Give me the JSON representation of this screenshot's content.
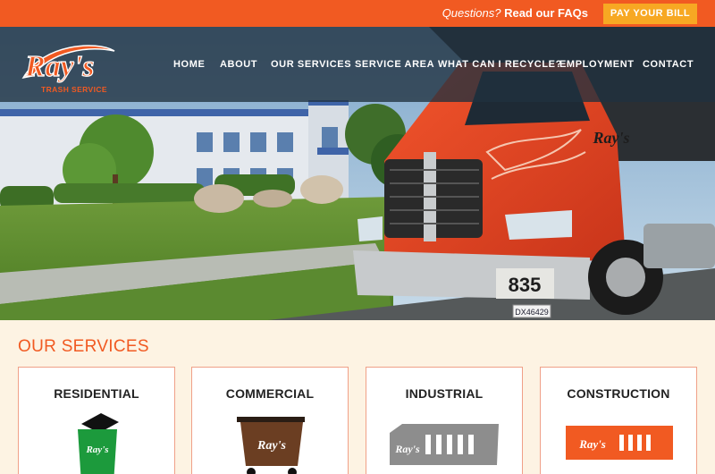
{
  "topbar": {
    "faq_prefix": "Questions?",
    "faq_link": "Read our FAQs",
    "pay_button": "PAY YOUR BILL"
  },
  "logo": {
    "name": "Ray's",
    "subtitle": "TRASH SERVICE"
  },
  "nav": {
    "items": [
      {
        "label": "HOME"
      },
      {
        "label": "ABOUT"
      },
      {
        "label": "OUR SERVICES"
      },
      {
        "label": "SERVICE AREA"
      },
      {
        "label": "WHAT CAN I RECYCLE?"
      },
      {
        "label": "EMPLOYMENT"
      },
      {
        "label": "CONTACT"
      }
    ]
  },
  "hero": {
    "truck_number": "835",
    "truck_brand": "Ray's",
    "plate": "DX46429"
  },
  "services": {
    "title": "OUR SERVICES",
    "cards": [
      {
        "label": "RESIDENTIAL",
        "icon": "green-trash-cart-icon"
      },
      {
        "label": "COMMERCIAL",
        "icon": "brown-dumpster-icon"
      },
      {
        "label": "INDUSTRIAL",
        "icon": "gray-compactor-icon"
      },
      {
        "label": "CONSTRUCTION",
        "icon": "orange-roll-off-icon"
      }
    ]
  },
  "colors": {
    "accent": "#f15a22",
    "pay": "#f7a823",
    "nav_bg": "#20313f",
    "page_bg": "#fdf3e3"
  }
}
